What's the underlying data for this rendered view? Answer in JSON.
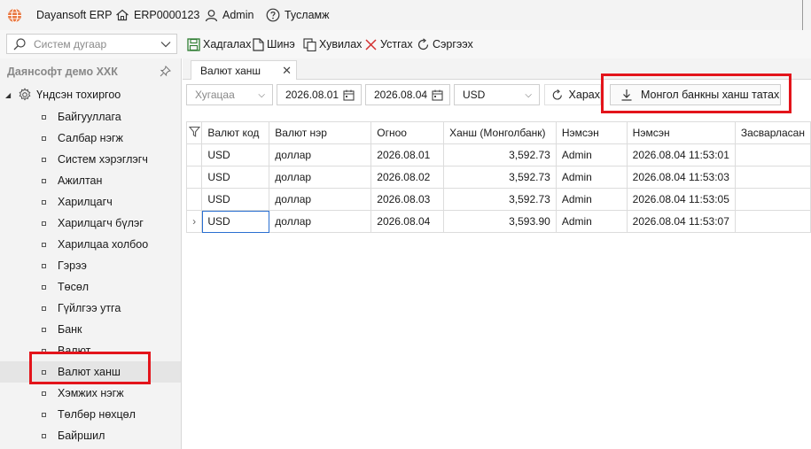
{
  "app": {
    "name": "Dayansoft ERP",
    "code": "ERP0000123",
    "user": "Admin",
    "help": "Тусламж"
  },
  "toolbar": {
    "search_placeholder": "Систем дугаар",
    "save": "Хадгалах",
    "new": "Шинэ",
    "copy": "Хувилах",
    "delete": "Устгах",
    "refresh": "Сэргээх"
  },
  "sidebar": {
    "company": "Даянсофт демо ХХК",
    "root": "Үндсэн тохиргоо",
    "items": [
      {
        "label": "Байгууллага"
      },
      {
        "label": "Салбар нэгж"
      },
      {
        "label": "Систем хэрэглэгч"
      },
      {
        "label": "Ажилтан"
      },
      {
        "label": "Харилцагч"
      },
      {
        "label": "Харилцагч бүлэг"
      },
      {
        "label": "Харилцаа холбоо"
      },
      {
        "label": "Гэрээ"
      },
      {
        "label": "Төсөл"
      },
      {
        "label": "Гүйлгээ утга"
      },
      {
        "label": "Банк"
      },
      {
        "label": "Валют"
      },
      {
        "label": "Валют ханш"
      },
      {
        "label": "Хэмжих нэгж"
      },
      {
        "label": "Төлбөр нөхцөл"
      },
      {
        "label": "Байршил"
      }
    ],
    "selected_index": 12
  },
  "tab": {
    "label": "Валют ханш"
  },
  "filters": {
    "period": "Хугацаа",
    "date_from": "2026.08.01",
    "date_to": "2026.08.04",
    "currency": "USD",
    "view": "Харах",
    "download": "Монгол банкны ханш татах"
  },
  "grid": {
    "columns": [
      "Валют код",
      "Валют нэр",
      "Огноо",
      "Ханш (Монголбанк)",
      "Нэмсэн",
      "Нэмсэн",
      "Засварласан"
    ],
    "rows": [
      [
        "USD",
        "доллар",
        "2026.08.01",
        "3,592.73",
        "Admin",
        "2026.08.04 11:53:01"
      ],
      [
        "USD",
        "доллар",
        "2026.08.02",
        "3,592.73",
        "Admin",
        "2026.08.04 11:53:03"
      ],
      [
        "USD",
        "доллар",
        "2026.08.03",
        "3,592.73",
        "Admin",
        "2026.08.04 11:53:05"
      ],
      [
        "USD",
        "доллар",
        "2026.08.04",
        "3,593.90",
        "Admin",
        "2026.08.04 11:53:07"
      ]
    ],
    "current_row": 3
  },
  "colors": {
    "highlight": "#e3141b",
    "logo": "#e8743b",
    "save_icon": "#2e7d32",
    "delete_icon": "#d32f2f",
    "focus": "#2a6fd1"
  }
}
